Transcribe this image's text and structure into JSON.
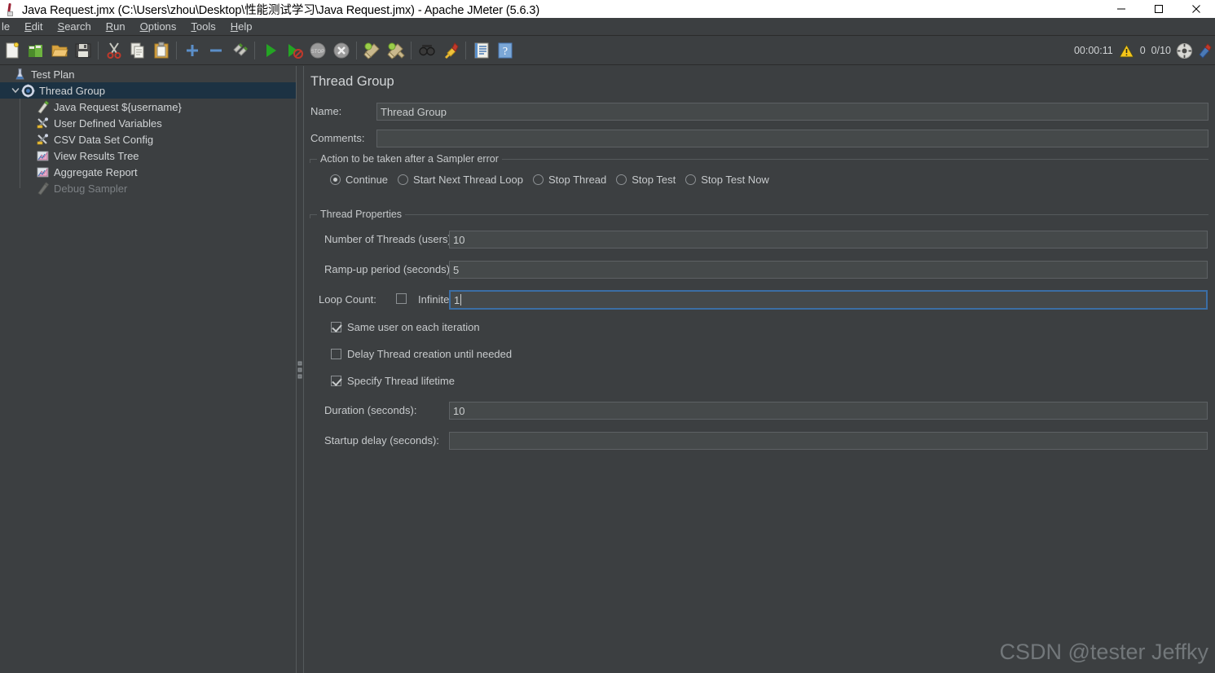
{
  "window": {
    "title": "Java Request.jmx (C:\\Users\\zhou\\Desktop\\性能测试学习\\Java Request.jmx) - Apache JMeter (5.6.3)",
    "app_icon": "jmeter-icon",
    "controls": {
      "minimize": "minimize-icon",
      "maximize": "maximize-icon",
      "close": "close-icon"
    }
  },
  "menubar": {
    "items": [
      {
        "label": "le",
        "mnemonic": ""
      },
      {
        "label": "Edit",
        "mnemonic": "E"
      },
      {
        "label": "Search",
        "mnemonic": "S"
      },
      {
        "label": "Run",
        "mnemonic": "R"
      },
      {
        "label": "Options",
        "mnemonic": "O"
      },
      {
        "label": "Tools",
        "mnemonic": "T"
      },
      {
        "label": "Help",
        "mnemonic": "H"
      }
    ]
  },
  "toolbar": {
    "buttons": [
      {
        "name": "new-icon"
      },
      {
        "name": "templates-icon"
      },
      {
        "name": "open-icon"
      },
      {
        "name": "save-icon"
      },
      {
        "name": "cut-icon"
      },
      {
        "name": "copy-icon"
      },
      {
        "name": "paste-icon"
      },
      {
        "name": "expand-all-icon"
      },
      {
        "name": "collapse-all-icon"
      },
      {
        "name": "toggle-icon"
      },
      {
        "name": "start-icon"
      },
      {
        "name": "start-no-pauses-icon"
      },
      {
        "name": "stop-icon"
      },
      {
        "name": "shutdown-icon"
      },
      {
        "name": "clear-icon"
      },
      {
        "name": "clear-all-icon"
      },
      {
        "name": "search-icon"
      },
      {
        "name": "reset-search-icon"
      },
      {
        "name": "function-helper-icon"
      },
      {
        "name": "help-icon"
      }
    ],
    "status": {
      "elapsed_time": "00:00:11",
      "warning_icon": "warning-icon",
      "warning_count": "0",
      "threads": "0/10",
      "connection_icon": "connection-icon",
      "extra_icon": "extra-icon"
    }
  },
  "tree": {
    "nodes": [
      {
        "label": "Test Plan",
        "icon": "test-plan-icon",
        "indent": 0,
        "selected": false,
        "disabled": false,
        "twisty": ""
      },
      {
        "label": "Thread Group",
        "icon": "thread-group-icon",
        "indent": 1,
        "selected": true,
        "disabled": false,
        "twisty": "expanded"
      },
      {
        "label": "Java Request ${username}",
        "icon": "java-request-icon",
        "indent": 2,
        "selected": false,
        "disabled": false,
        "twisty": ""
      },
      {
        "label": "User Defined Variables",
        "icon": "config-element-icon",
        "indent": 2,
        "selected": false,
        "disabled": false,
        "twisty": ""
      },
      {
        "label": "CSV Data Set Config",
        "icon": "config-element-icon",
        "indent": 2,
        "selected": false,
        "disabled": false,
        "twisty": ""
      },
      {
        "label": "View Results Tree",
        "icon": "listener-icon",
        "indent": 2,
        "selected": false,
        "disabled": false,
        "twisty": ""
      },
      {
        "label": "Aggregate Report",
        "icon": "listener-icon",
        "indent": 2,
        "selected": false,
        "disabled": false,
        "twisty": ""
      },
      {
        "label": "Debug Sampler",
        "icon": "sampler-icon",
        "indent": 2,
        "selected": false,
        "disabled": true,
        "twisty": ""
      }
    ]
  },
  "main": {
    "title": "Thread Group",
    "name_label": "Name:",
    "name_value": "Thread Group",
    "comments_label": "Comments:",
    "comments_value": "",
    "sampler_error": {
      "legend": "Action to be taken after a Sampler error",
      "options": [
        {
          "label": "Continue",
          "selected": true
        },
        {
          "label": "Start Next Thread Loop",
          "selected": false
        },
        {
          "label": "Stop Thread",
          "selected": false
        },
        {
          "label": "Stop Test",
          "selected": false
        },
        {
          "label": "Stop Test Now",
          "selected": false
        }
      ]
    },
    "thread_properties": {
      "legend": "Thread Properties",
      "num_threads_label": "Number of Threads (users):",
      "num_threads_value": "10",
      "rampup_label": "Ramp-up period (seconds):",
      "rampup_value": "5",
      "loop_count_label": "Loop Count:",
      "infinite_label": "Infinite",
      "infinite_checked": false,
      "loop_count_value": "1",
      "loop_count_focused": true,
      "same_user_label": "Same user on each iteration",
      "same_user_checked": true,
      "delay_thread_label": "Delay Thread creation until needed",
      "delay_thread_checked": false,
      "specify_lifetime_label": "Specify Thread lifetime",
      "specify_lifetime_checked": true,
      "duration_label": "Duration (seconds):",
      "duration_value": "10",
      "startup_delay_label": "Startup delay (seconds):",
      "startup_delay_value": ""
    }
  },
  "watermark": "CSDN @tester Jeffky",
  "colors": {
    "background": "#3c3f41",
    "selection": "#1c3243",
    "field_bg": "#45494a",
    "focus_border": "#3b6ea5",
    "text": "#c7cacc"
  }
}
